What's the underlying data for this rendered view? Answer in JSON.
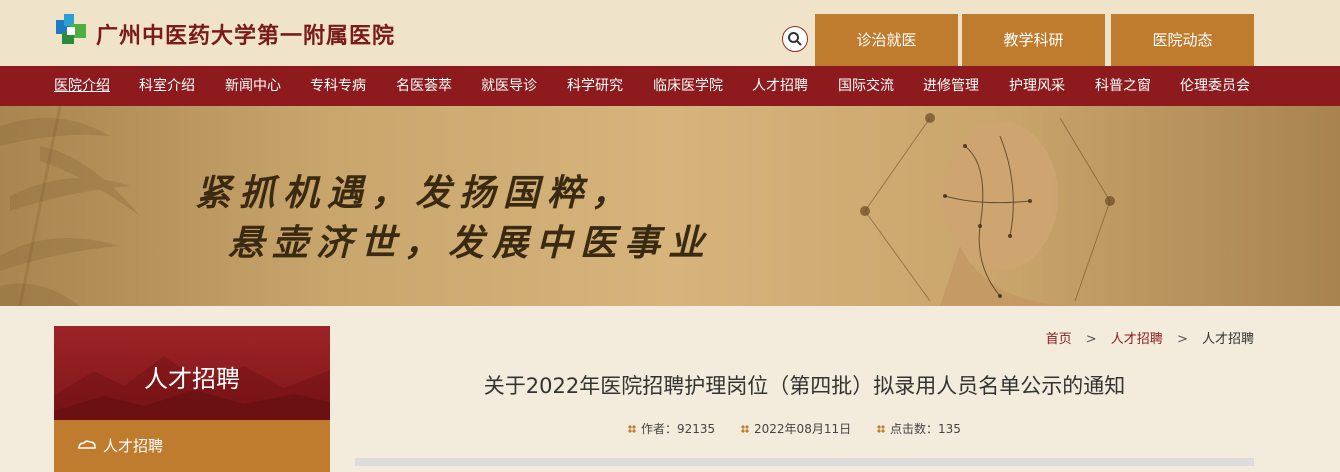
{
  "header": {
    "site_name": "广州中医药大学第一附属医院",
    "tabs": [
      "诊治就医",
      "教学科研",
      "医院动态"
    ]
  },
  "nav": {
    "items": [
      "医院介绍",
      "科室介绍",
      "新闻中心",
      "专科专病",
      "名医荟萃",
      "就医导诊",
      "科学研究",
      "临床医学院",
      "人才招聘",
      "国际交流",
      "进修管理",
      "护理风采",
      "科普之窗",
      "伦理委员会"
    ]
  },
  "banner": {
    "slogan_line1": "紧抓机遇，发扬国粹，",
    "slogan_line2": "悬壶济世，发展中医事业"
  },
  "sidebar": {
    "header_title": "人才招聘",
    "items": [
      {
        "label": "人才招聘"
      }
    ]
  },
  "breadcrumb": [
    "首页",
    "人才招聘",
    "人才招聘"
  ],
  "article": {
    "title": "关于2022年医院招聘护理岗位（第四批）拟录用人员名单公示的通知",
    "author": "作者：92135",
    "date": "2022年08月11日",
    "clicks": "点击数：135"
  },
  "colors": {
    "brand_red": "#8d1b1d",
    "accent_gold": "#c07c2e",
    "header_bg": "#efe4c9"
  }
}
